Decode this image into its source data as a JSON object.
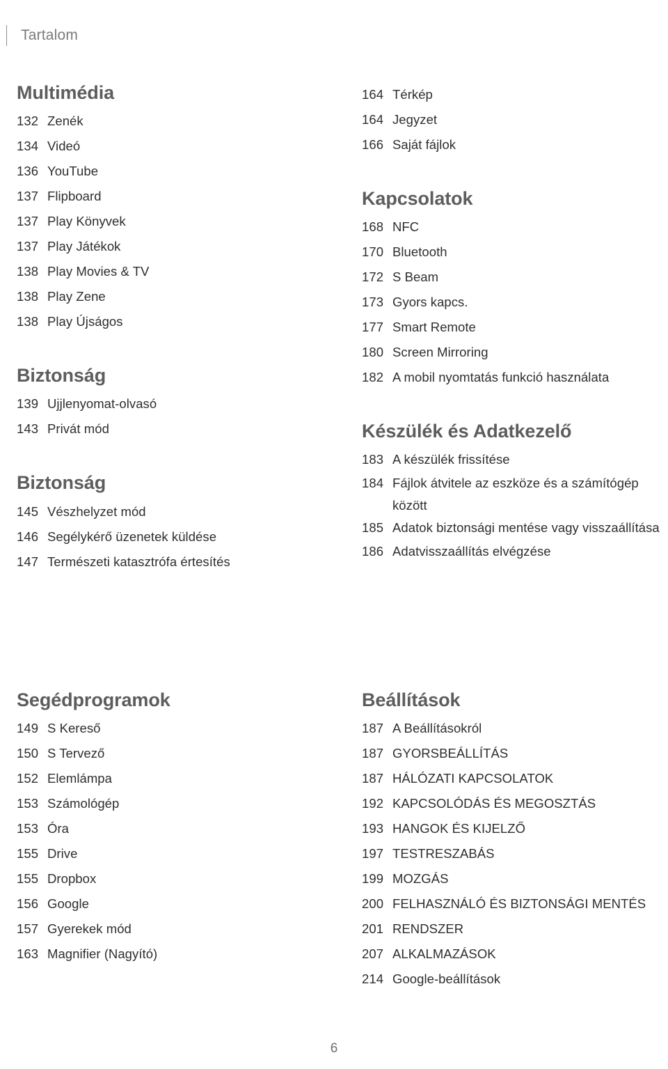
{
  "header": {
    "title": "Tartalom"
  },
  "columns": {
    "block1": {
      "left": [
        {
          "title": "Multimédia",
          "items": [
            {
              "page": "132",
              "label": "Zenék"
            },
            {
              "page": "134",
              "label": "Videó"
            },
            {
              "page": "136",
              "label": "YouTube"
            },
            {
              "page": "137",
              "label": "Flipboard"
            },
            {
              "page": "137",
              "label": "Play Könyvek"
            },
            {
              "page": "137",
              "label": "Play Játékok"
            },
            {
              "page": "138",
              "label": "Play Movies & TV"
            },
            {
              "page": "138",
              "label": "Play Zene"
            },
            {
              "page": "138",
              "label": "Play Újságos"
            }
          ]
        },
        {
          "title": "Biztonság",
          "items": [
            {
              "page": "139",
              "label": "Ujjlenyomat-olvasó"
            },
            {
              "page": "143",
              "label": "Privát mód"
            }
          ]
        },
        {
          "title": "Biztonság",
          "items": [
            {
              "page": "145",
              "label": "Vészhelyzet mód"
            },
            {
              "page": "146",
              "label": "Segélykérő üzenetek küldése"
            },
            {
              "page": "147",
              "label": "Természeti katasztrófa értesítés"
            }
          ]
        }
      ],
      "right": [
        {
          "title": "",
          "items": [
            {
              "page": "164",
              "label": "Térkép"
            },
            {
              "page": "164",
              "label": "Jegyzet"
            },
            {
              "page": "166",
              "label": "Saját fájlok"
            }
          ]
        },
        {
          "title": "Kapcsolatok",
          "items": [
            {
              "page": "168",
              "label": "NFC"
            },
            {
              "page": "170",
              "label": "Bluetooth"
            },
            {
              "page": "172",
              "label": "S Beam"
            },
            {
              "page": "173",
              "label": "Gyors kapcs."
            },
            {
              "page": "177",
              "label": "Smart Remote"
            },
            {
              "page": "180",
              "label": "Screen Mirroring"
            },
            {
              "page": "182",
              "label": "A mobil nyomtatás funkció használata"
            }
          ]
        },
        {
          "title": "Készülék és Adatkezelő",
          "items": [
            {
              "page": "183",
              "label": "A készülék frissítése"
            },
            {
              "page": "184",
              "label": "Fájlok átvitele az eszköze és a számítógép között",
              "wrap": true
            },
            {
              "page": "185",
              "label": "Adatok biztonsági mentése vagy visszaállítása",
              "wrap": true
            },
            {
              "page": "186",
              "label": "Adatvisszaállítás elvégzése"
            }
          ]
        }
      ]
    },
    "block2": {
      "left": [
        {
          "title": "Segédprogramok",
          "items": [
            {
              "page": "149",
              "label": "S Kereső"
            },
            {
              "page": "150",
              "label": "S Tervező"
            },
            {
              "page": "152",
              "label": "Elemlámpa"
            },
            {
              "page": "153",
              "label": "Számológép"
            },
            {
              "page": "153",
              "label": "Óra"
            },
            {
              "page": "155",
              "label": "Drive"
            },
            {
              "page": "155",
              "label": "Dropbox"
            },
            {
              "page": "156",
              "label": "Google"
            },
            {
              "page": "157",
              "label": "Gyerekek mód"
            },
            {
              "page": "163",
              "label": "Magnifier (Nagyító)"
            }
          ]
        }
      ],
      "right": [
        {
          "title": "Beállítások",
          "items": [
            {
              "page": "187",
              "label": "A Beállításokról"
            },
            {
              "page": "187",
              "label": "GYORSBEÁLLÍTÁS"
            },
            {
              "page": "187",
              "label": "HÁLÓZATI KAPCSOLATOK"
            },
            {
              "page": "192",
              "label": "KAPCSOLÓDÁS ÉS MEGOSZTÁS"
            },
            {
              "page": "193",
              "label": "HANGOK ÉS KIJELZŐ"
            },
            {
              "page": "197",
              "label": "TESTRESZABÁS"
            },
            {
              "page": "199",
              "label": "MOZGÁS"
            },
            {
              "page": "200",
              "label": "FELHASZNÁLÓ ÉS BIZTONSÁGI MENTÉS"
            },
            {
              "page": "201",
              "label": "RENDSZER"
            },
            {
              "page": "207",
              "label": "ALKALMAZÁSOK"
            },
            {
              "page": "214",
              "label": "Google-beállítások"
            }
          ]
        }
      ]
    }
  },
  "folio": {
    "page_number": "6"
  },
  "colors": {
    "heading": "#5d5d5d",
    "body": "#2e2e2e",
    "header_title": "#7a7a7a",
    "rule": "#8c8c8c"
  }
}
